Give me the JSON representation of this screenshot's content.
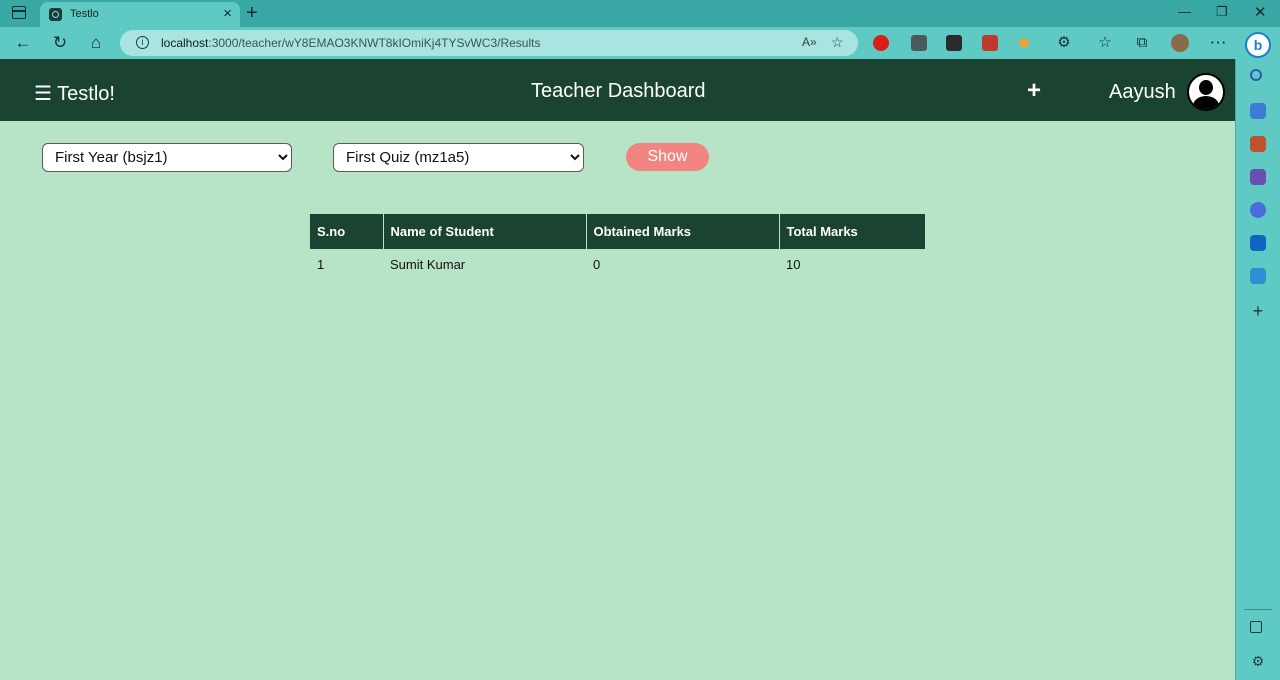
{
  "browser": {
    "tab_title": "Testlo",
    "url_host": "localhost",
    "url_path": ":3000/teacher/wY8EMAO3KNWT8kIOmiKj4TYSvWC3/Results",
    "read_aloud": "A»"
  },
  "header": {
    "menu_icon": "☰",
    "brand": "Testlo!",
    "title": "Teacher Dashboard",
    "add_icon": "+",
    "user_name": "Aayush"
  },
  "filters": {
    "class_options": [
      "First Year (bsjz1)"
    ],
    "quiz_options": [
      "First Quiz (mz1a5)"
    ],
    "show_label": "Show"
  },
  "table": {
    "headers": [
      "S.no",
      "Name of Student",
      "Obtained Marks",
      "Total Marks"
    ],
    "rows": [
      [
        "1",
        "Sumit Kumar",
        "0",
        "10"
      ]
    ]
  },
  "colors": {
    "header_bg": "#1b4332",
    "page_bg": "#b7e4c7",
    "button_bg": "#f28482",
    "browser_chrome": "#5fc9c4"
  }
}
